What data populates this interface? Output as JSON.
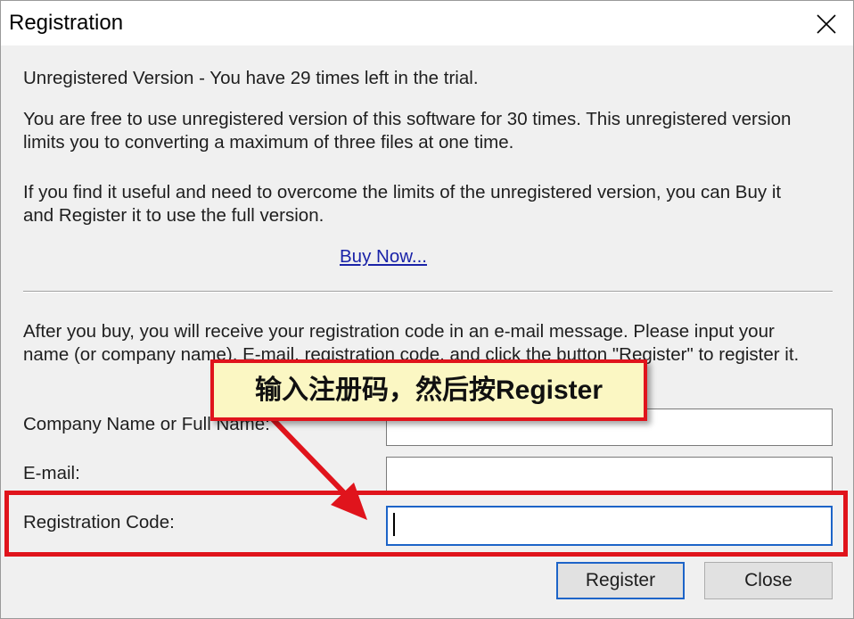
{
  "window": {
    "title": "Registration"
  },
  "body": {
    "trial_status": "Unregistered Version - You have 29 times left in the trial.",
    "trial_info_line1": "You are free to use unregistered version of this software for 30 times. This unregistered version",
    "trial_info_line2": "limits you to converting a maximum of three files at one time.",
    "buy_info_line1": "If you find it useful and need to overcome the limits of the unregistered version, you can Buy it",
    "buy_info_line2": "and Register it to use the full version.",
    "buy_link": "Buy Now...",
    "instructions_line1": "After you buy, you will receive your registration code in an e-mail message. Please input your",
    "instructions_line2": "name (or company name), E-mail, registration code, and click the button \"Register\" to register it."
  },
  "form": {
    "name_label": "Company Name or Full Name:",
    "name_value": "",
    "email_label": "E-mail:",
    "email_value": "",
    "code_label": "Registration Code:",
    "code_value": ""
  },
  "buttons": {
    "register": "Register",
    "close": "Close"
  },
  "annotation": {
    "callout": "输入注册码，然后按Register",
    "color": "#e0141c"
  },
  "icons": {
    "close": "close-icon"
  }
}
